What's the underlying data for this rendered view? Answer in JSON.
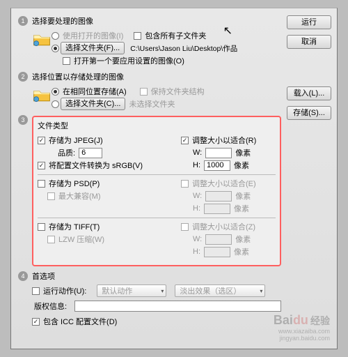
{
  "buttons": {
    "run": "运行",
    "cancel": "取消",
    "load": "载入(L)...",
    "save": "存储(S)..."
  },
  "sec1": {
    "title": "选择要处理的图像",
    "use_open_images": "使用打开的图像(I)",
    "include_subfolders": "包含所有子文件夹",
    "choose_folder_btn": "选择文件夹(F)...",
    "path": "C:\\Users\\Jason Liu\\Desktop\\作品",
    "skip_first_open": "打开第一个要应用设置的图像(O)"
  },
  "sec2": {
    "title": "选择位置以存储处理的图像",
    "same_location": "在相同位置存储(A)",
    "keep_structure": "保持文件夹结构",
    "choose_folder_btn": "选择文件夹(C)...",
    "no_folder": "未选择文件夹"
  },
  "sec3": {
    "title": "文件类型",
    "jpeg": {
      "save": "存储为 JPEG(J)",
      "quality_label": "品质:",
      "quality": "6",
      "srgb": "将配置文件转换为 sRGB(V)",
      "resize": "调整大小以适合(R)",
      "width": "",
      "height": "1000",
      "unit": "像素",
      "w_label": "W:",
      "h_label": "H:"
    },
    "psd": {
      "save": "存储为 PSD(P)",
      "max_compat": "最大兼容(M)",
      "resize": "调整大小以适合(E)",
      "unit": "像素",
      "w_label": "W:",
      "h_label": "H:"
    },
    "tiff": {
      "save": "存储为 TIFF(T)",
      "lzw": "LZW 压缩(W)",
      "resize": "调整大小以适合(Z)",
      "unit": "像素",
      "w_label": "W:",
      "h_label": "H:"
    }
  },
  "sec4": {
    "title": "首选项",
    "run_action": "运行动作(U):",
    "action_set": "默认动作",
    "action": "淡出效果（选区）",
    "copyright_label": "版权信息:",
    "icc": "包含 ICC 配置文件(D)"
  },
  "watermark": {
    "brand": "Bai",
    "brand2": "du",
    "cn": "经验",
    "url": "jingyan.baidu.com",
    "xz": "www.xiazaiba.com"
  }
}
